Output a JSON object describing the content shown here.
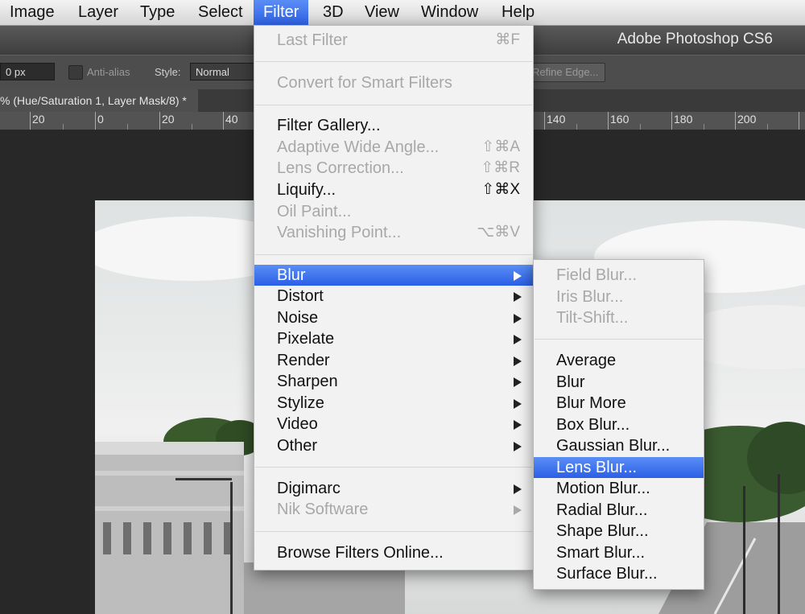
{
  "menubar": {
    "items": [
      "Image",
      "Layer",
      "Type",
      "Select",
      "Filter",
      "3D",
      "View",
      "Window",
      "Help"
    ],
    "active": "Filter"
  },
  "app_title": "Adobe Photoshop CS6",
  "options_bar": {
    "feather_value": "0 px",
    "antialias_label": "Anti-alias",
    "style_label": "Style:",
    "style_value": "Normal",
    "refine_edge_label": "Refine Edge..."
  },
  "document_tab": {
    "title": "% (Hue/Saturation 1, Layer Mask/8) *"
  },
  "ruler": {
    "labels": [
      "20",
      "0",
      "20",
      "40",
      "140",
      "160",
      "180",
      "200"
    ]
  },
  "filter_menu": {
    "items": [
      {
        "label": "Last Filter",
        "shortcut": "⌘F",
        "disabled": true
      },
      {
        "label": "Convert for Smart Filters",
        "disabled": true
      },
      {
        "label": "Filter Gallery...",
        "disabled": false
      },
      {
        "label": "Adaptive Wide Angle...",
        "shortcut": "⇧⌘A",
        "disabled": true
      },
      {
        "label": "Lens Correction...",
        "shortcut": "⇧⌘R",
        "disabled": true
      },
      {
        "label": "Liquify...",
        "shortcut": "⇧⌘X",
        "disabled": false
      },
      {
        "label": "Oil Paint...",
        "disabled": true
      },
      {
        "label": "Vanishing Point...",
        "shortcut": "⌥⌘V",
        "disabled": true
      },
      {
        "label": "Blur",
        "submenu": true,
        "highlighted": true
      },
      {
        "label": "Distort",
        "submenu": true
      },
      {
        "label": "Noise",
        "submenu": true
      },
      {
        "label": "Pixelate",
        "submenu": true
      },
      {
        "label": "Render",
        "submenu": true
      },
      {
        "label": "Sharpen",
        "submenu": true
      },
      {
        "label": "Stylize",
        "submenu": true
      },
      {
        "label": "Video",
        "submenu": true
      },
      {
        "label": "Other",
        "submenu": true
      },
      {
        "label": "Digimarc",
        "submenu": true
      },
      {
        "label": "Nik Software",
        "submenu": true,
        "disabled": true
      },
      {
        "label": "Browse Filters Online..."
      }
    ]
  },
  "blur_submenu": {
    "items": [
      {
        "label": "Field Blur...",
        "disabled": true
      },
      {
        "label": "Iris Blur...",
        "disabled": true
      },
      {
        "label": "Tilt-Shift...",
        "disabled": true
      },
      {
        "label": "Average"
      },
      {
        "label": "Blur"
      },
      {
        "label": "Blur More"
      },
      {
        "label": "Box Blur..."
      },
      {
        "label": "Gaussian Blur..."
      },
      {
        "label": "Lens Blur...",
        "highlighted": true
      },
      {
        "label": "Motion Blur..."
      },
      {
        "label": "Radial Blur..."
      },
      {
        "label": "Shape Blur..."
      },
      {
        "label": "Smart Blur..."
      },
      {
        "label": "Surface Blur..."
      }
    ]
  },
  "colors": {
    "highlight": "#2f62e6",
    "menu_bg": "#f2f2f2",
    "disabled_text": "#a8a8a8"
  }
}
